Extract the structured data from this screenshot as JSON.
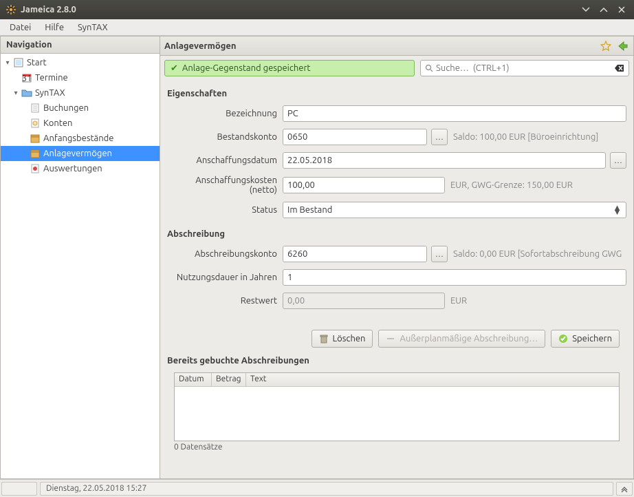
{
  "window": {
    "title": "Jameica 2.8.0"
  },
  "menu": {
    "file": "Datei",
    "help": "Hilfe",
    "syntax": "SynTAX"
  },
  "sidebar": {
    "header": "Navigation",
    "items": [
      {
        "label": "Start"
      },
      {
        "label": "Termine"
      },
      {
        "label": "SynTAX"
      },
      {
        "label": "Buchungen"
      },
      {
        "label": "Konten"
      },
      {
        "label": "Anfangsbestände"
      },
      {
        "label": "Anlagevermögen"
      },
      {
        "label": "Auswertungen"
      }
    ]
  },
  "content": {
    "title": "Anlagevermögen",
    "success_msg": "Anlage-Gegenstand gespeichert",
    "search_placeholder": "Suche…  (CTRL+1)"
  },
  "sections": {
    "properties": "Eigenschaften",
    "depreciation": "Abschreibung",
    "booked": "Bereits gebuchte Abschreibungen"
  },
  "fields": {
    "bezeichnung": {
      "label": "Bezeichnung",
      "value": "PC"
    },
    "bestandskonto": {
      "label": "Bestandskonto",
      "value": "0650",
      "hint": "Saldo: 100,00 EUR [Büroeinrichtung]"
    },
    "anschaffungsdatum": {
      "label": "Anschaffungsdatum",
      "value": "22.05.2018"
    },
    "anschaffungskosten": {
      "label": "Anschaffungskosten (netto)",
      "value": "100,00",
      "hint": "EUR, GWG-Grenze: 150,00 EUR"
    },
    "status": {
      "label": "Status",
      "value": "Im Bestand"
    },
    "abschreibungskonto": {
      "label": "Abschreibungskonto",
      "value": "6260",
      "hint": "Saldo: 0,00 EUR [Sofortabschreibung GWG"
    },
    "nutzungsdauer": {
      "label": "Nutzungsdauer in Jahren",
      "value": "1"
    },
    "restwert": {
      "label": "Restwert",
      "value": "0,00",
      "hint": "EUR"
    }
  },
  "buttons": {
    "delete": "Löschen",
    "extra": "Außerplanmäßige Abschreibung…",
    "save": "Speichern"
  },
  "table": {
    "cols": {
      "date": "Datum",
      "amount": "Betrag",
      "text": "Text"
    },
    "footer": "0 Datensätze"
  },
  "status": {
    "datetime": "Dienstag, 22.05.2018 15:27"
  }
}
